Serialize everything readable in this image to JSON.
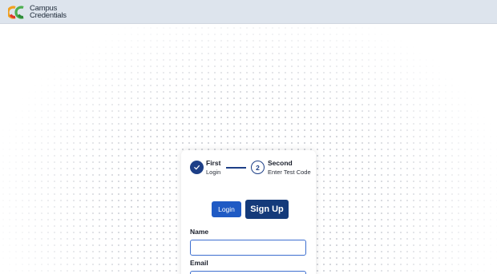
{
  "header": {
    "logo_line1": "Campus",
    "logo_line2": "Credentials",
    "brand_colors": {
      "orange": "#f0a020",
      "red": "#e0382a",
      "green": "#4caf50"
    }
  },
  "stepper": {
    "step1": {
      "title": "First",
      "subtitle": "Login",
      "icon": "check-icon",
      "state": "done"
    },
    "step2": {
      "number": "2",
      "title": "Second",
      "subtitle": "Enter Test Code",
      "state": "active"
    }
  },
  "auth_tabs": {
    "login_label": "Login",
    "signup_label": "Sign Up"
  },
  "form": {
    "name_label": "Name",
    "name_value": "",
    "email_label": "Email",
    "email_value": ""
  },
  "colors": {
    "primary": "#1d3f87",
    "button": "#1f5ac4",
    "input_border": "#3d6fd0",
    "header_bg": "#dde4ed"
  }
}
